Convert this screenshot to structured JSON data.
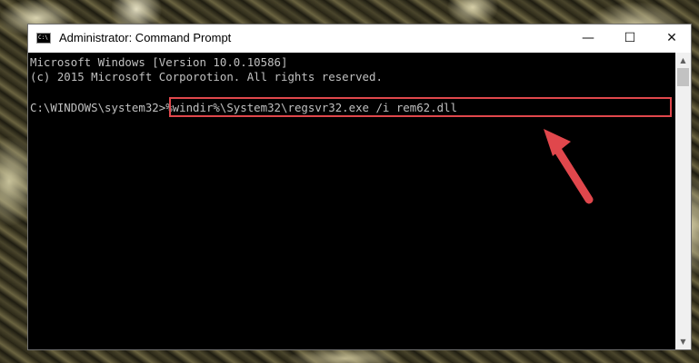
{
  "window": {
    "title": "Administrator: Command Prompt",
    "icon_label": "C:\\",
    "controls": {
      "minimize": "—",
      "maximize": "☐",
      "close": "✕"
    }
  },
  "console": {
    "line1": "Microsoft Windows [Version 10.0.10586]",
    "line2": "(c) 2015 Microsoft Corporotion. All rights reserved.",
    "prompt": "C:\\WINDOWS\\system32>",
    "command": "%windir%\\System32\\regsvr32.exe /i rem62.dll"
  },
  "scrollbar": {
    "up": "▲",
    "down": "▼"
  },
  "colors": {
    "console_bg": "#000000",
    "console_text": "#c0c0c0",
    "highlight": "#e0474c",
    "arrow": "#e0474c"
  },
  "icons": [
    "cmd-app-icon",
    "minimize-icon",
    "maximize-icon",
    "close-icon",
    "red-arrow-annotation"
  ]
}
